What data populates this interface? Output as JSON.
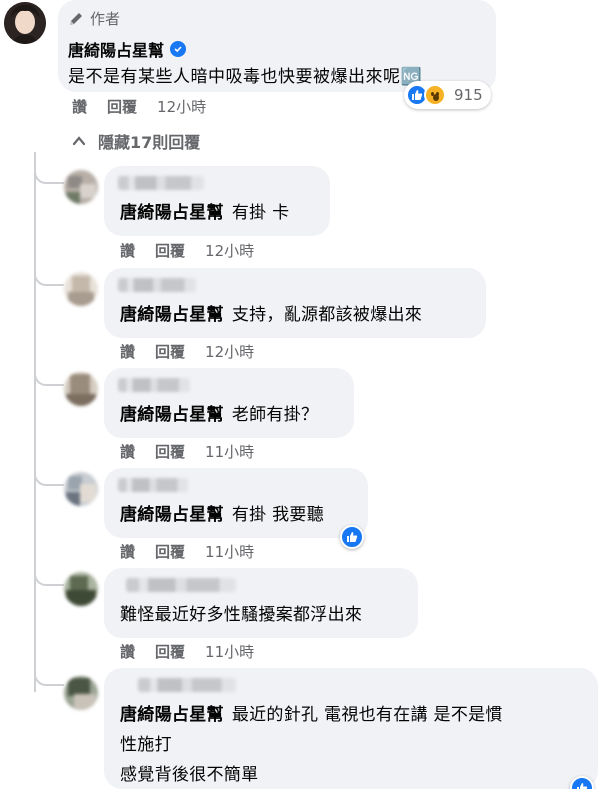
{
  "top_comment": {
    "author_badge": "作者",
    "name": "唐綺陽占星幫",
    "text": "是不是有某些人暗中吸毒也快要被爆出來呢🆖",
    "reaction_count": "915",
    "actions": {
      "like": "讚",
      "reply": "回覆",
      "time": "12小時"
    }
  },
  "hide_replies_label": "隱藏17則回覆",
  "replies": [
    {
      "mention": "唐綺陽占星幫",
      "text": "有掛 卡",
      "like": "讚",
      "reply": "回覆",
      "time": "12小時"
    },
    {
      "mention": "唐綺陽占星幫",
      "text": "支持，亂源都該被爆出來",
      "like": "讚",
      "reply": "回覆",
      "time": "12小時"
    },
    {
      "mention": "唐綺陽占星幫",
      "text": "老師有掛？",
      "like": "讚",
      "reply": "回覆",
      "time": "11小時"
    },
    {
      "mention": "唐綺陽占星幫",
      "text": "有掛 我要聽",
      "like": "讚",
      "reply": "回覆",
      "time": "11小時"
    },
    {
      "mention": "",
      "text": "難怪最近好多性騷擾案都浮出來",
      "like": "讚",
      "reply": "回覆",
      "time": "11小時"
    },
    {
      "mention": "唐綺陽占星幫",
      "text_line1": "最近的針孔 電視也有在講 是不是慣",
      "text_line2": "性施打",
      "text_line3": "感覺背後很不簡單"
    }
  ],
  "icons": {
    "author": "pen-icon",
    "verified": "verified-badge-icon",
    "like": "thumbs-up-icon",
    "wow": "wow-face-icon",
    "collapse": "chevron-up-icon"
  },
  "colors": {
    "accent": "#1877f2",
    "bubble": "#f0f2f5",
    "muted_text": "#65676b",
    "thread_line": "#ced0d4"
  }
}
